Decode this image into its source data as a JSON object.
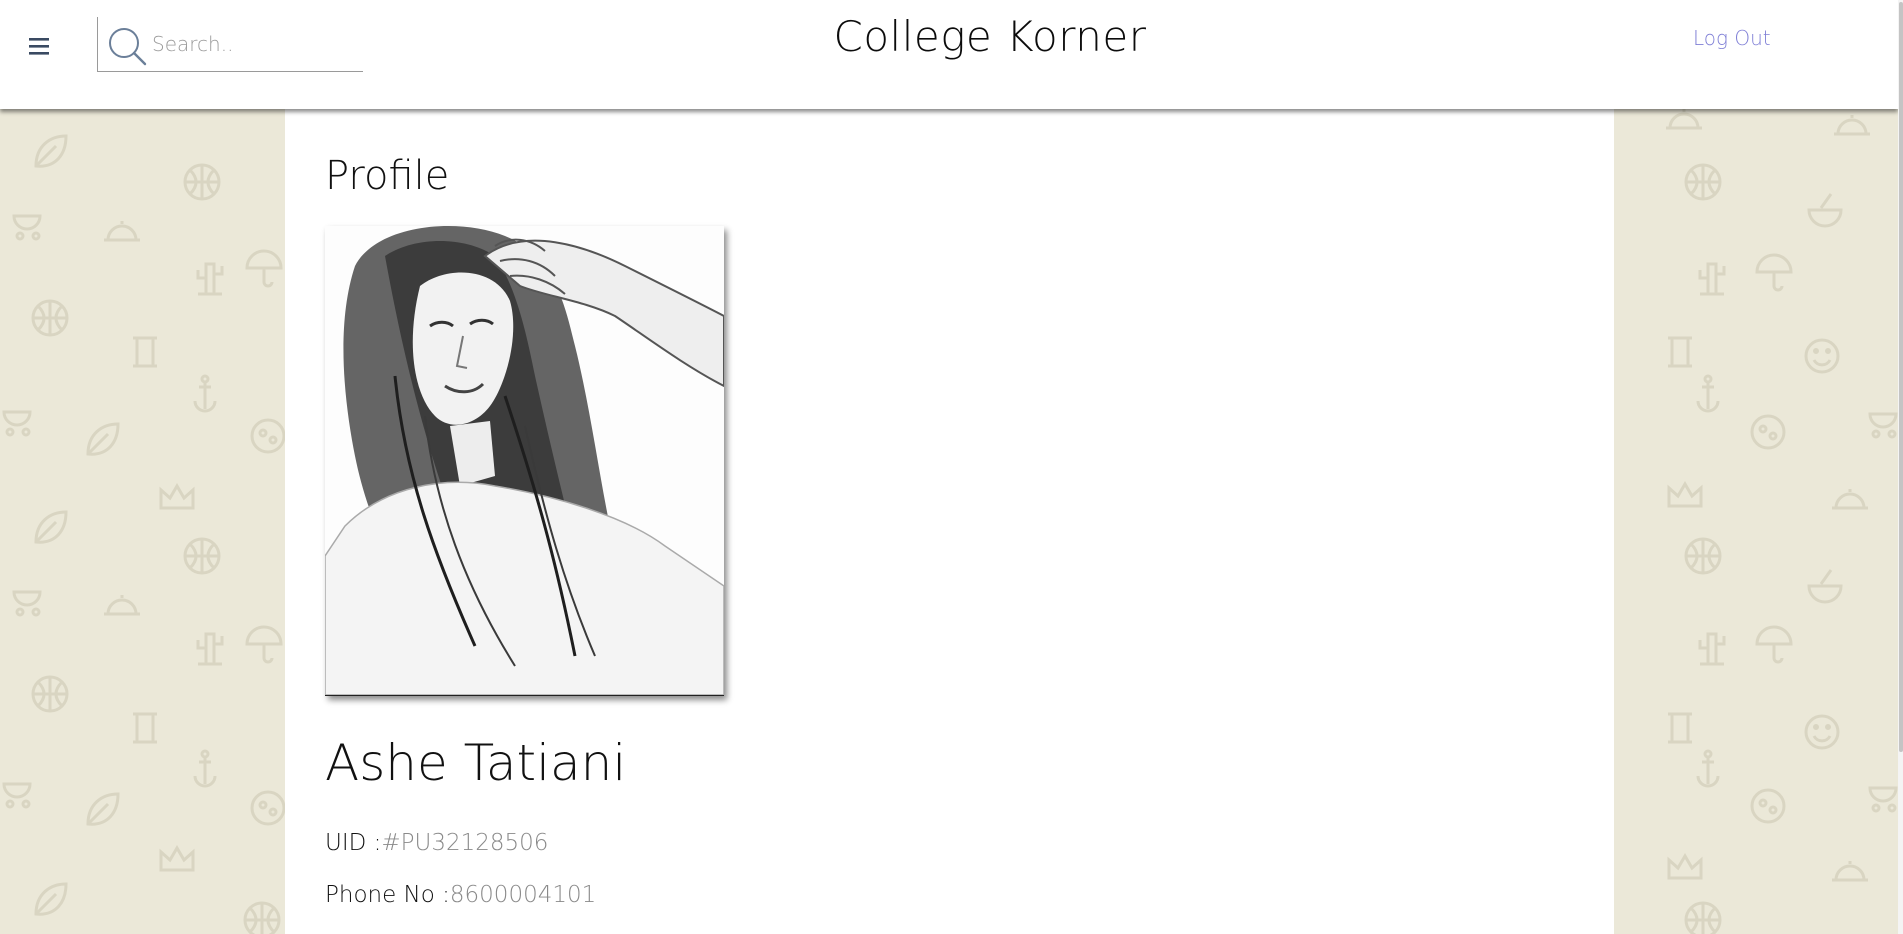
{
  "header": {
    "menu_icon": "hamburger-menu-icon",
    "search": {
      "placeholder": "Search..",
      "value": "",
      "icon": "search-icon"
    },
    "title": "College Korner",
    "logout_label": "Log Out"
  },
  "profile": {
    "heading": "Profile",
    "photo": "profile-photo-sketch",
    "name": "Ashe Tatiani",
    "uid_label": "UID :",
    "uid_value": "#PU32128506",
    "phone_label": "Phone No :",
    "phone_value": "8600004101"
  },
  "colors": {
    "background": "#ebe8d8",
    "pattern_icons": "#ddd9c7",
    "panel": "#ffffff",
    "link": "#7f7fd6",
    "muted_value": "#8a8a8a"
  }
}
